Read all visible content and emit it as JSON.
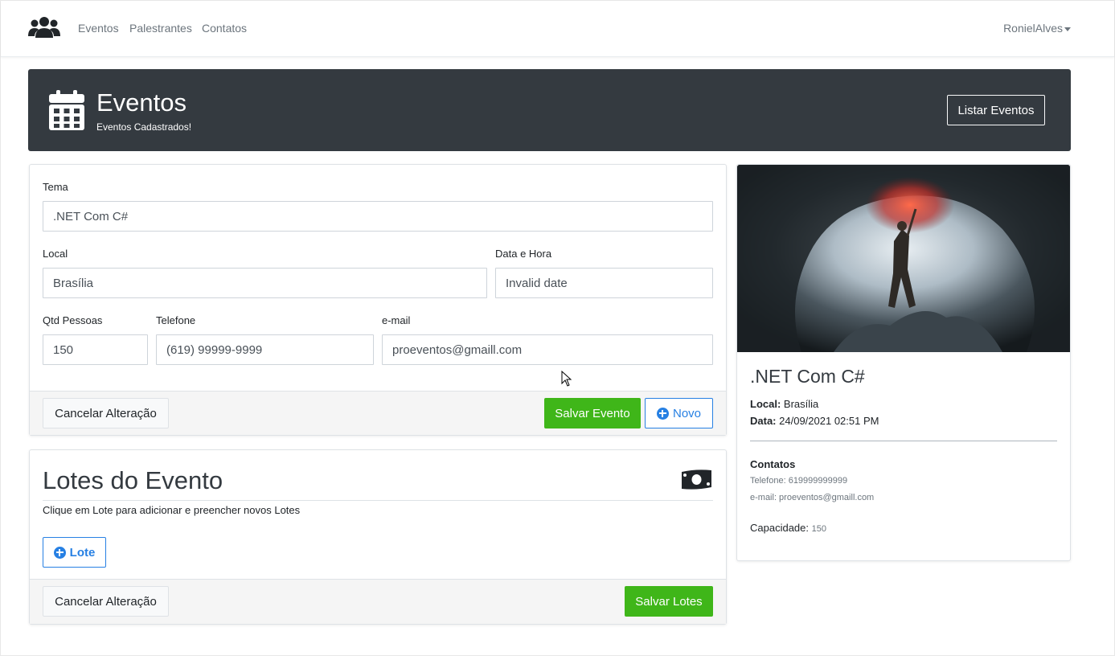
{
  "nav": {
    "links": [
      "Eventos",
      "Palestrantes",
      "Contatos"
    ],
    "user": "RonielAlves"
  },
  "header": {
    "title": "Eventos",
    "subtitle": "Eventos Cadastrados!",
    "list_button": "Listar Eventos"
  },
  "form": {
    "tema_label": "Tema",
    "tema_value": ".NET Com C#",
    "local_label": "Local",
    "local_value": "Brasília",
    "data_label": "Data e Hora",
    "data_value": "Invalid date",
    "qtd_label": "Qtd Pessoas",
    "qtd_value": "150",
    "telefone_label": "Telefone",
    "telefone_value": "(619) 99999-9999",
    "email_label": "e-mail",
    "email_value": "proeventos@gmaill.com",
    "cancel_button": "Cancelar Alteração",
    "save_button": "Salvar Evento",
    "new_button": "Novo"
  },
  "lotes": {
    "title": "Lotes do Evento",
    "description": "Clique em Lote para adicionar e preencher novos Lotes",
    "add_button": "Lote",
    "cancel_button": "Cancelar Alteração",
    "save_button": "Salvar Lotes"
  },
  "preview": {
    "title": ".NET Com C#",
    "local_label": "Local:",
    "local_value": "Brasília",
    "data_label": "Data:",
    "data_value": "24/09/2021 02:51 PM",
    "contatos_title": "Contatos",
    "telefone": "Telefone: 619999999999",
    "email": "e-mail: proeventos@gmaill.com",
    "capacidade_label": "Capacidade:",
    "capacidade_value": "150"
  },
  "colors": {
    "header_bg": "#343a40",
    "success": "#3fb619",
    "primary": "#2780e3"
  }
}
